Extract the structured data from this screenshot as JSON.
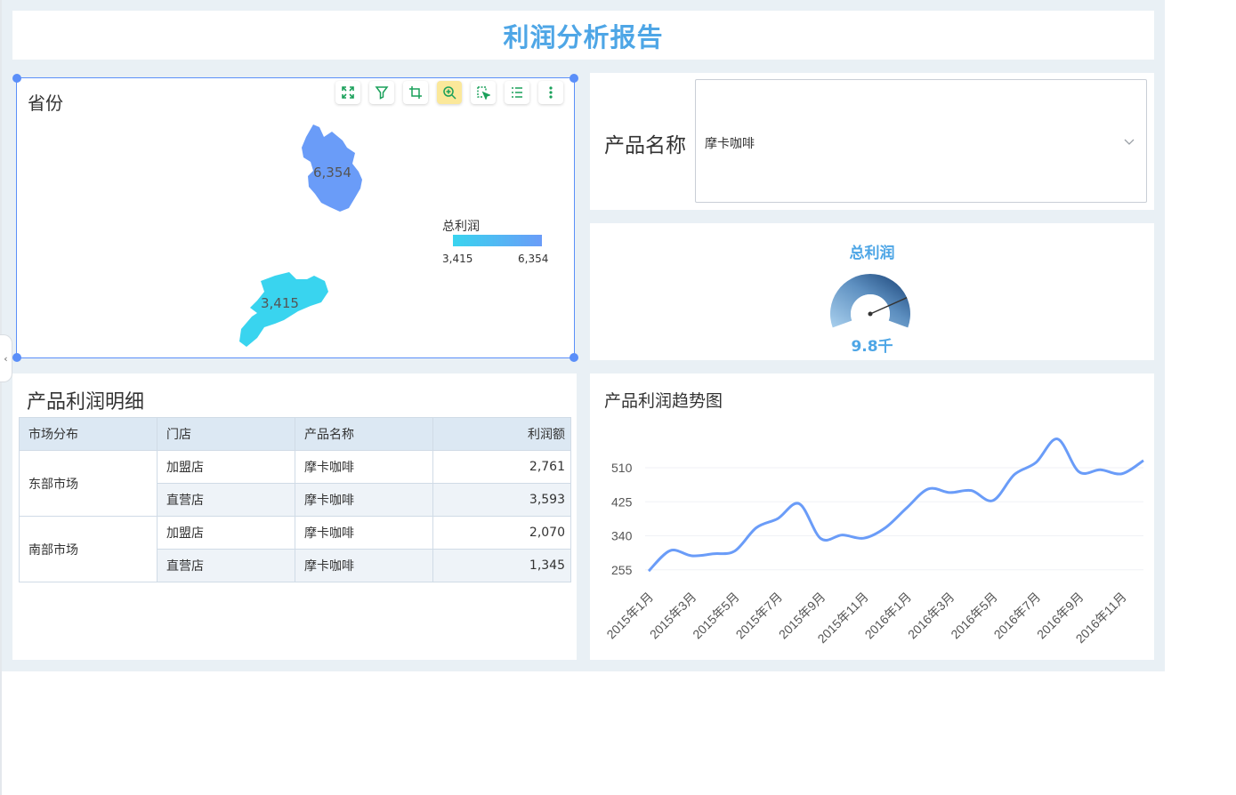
{
  "report": {
    "title": "利润分析报告"
  },
  "map_panel": {
    "title": "省份",
    "toolbar": [
      {
        "icon": "fullscreen-icon",
        "active": false
      },
      {
        "icon": "filter-icon",
        "active": false
      },
      {
        "icon": "crop-icon",
        "active": false
      },
      {
        "icon": "zoom-in-icon",
        "active": true
      },
      {
        "icon": "box-select-icon",
        "active": false
      },
      {
        "icon": "list-icon",
        "active": false
      },
      {
        "icon": "more-vertical-icon",
        "active": false
      }
    ],
    "regions": [
      {
        "name": "安徽",
        "value": 6354,
        "label": "6,354",
        "color": "#6a9cf8"
      },
      {
        "name": "广东",
        "value": 3415,
        "label": "3,415",
        "color": "#39d4ef"
      }
    ],
    "legend": {
      "title": "总利润",
      "min": "3,415",
      "max": "6,354",
      "color_min": "#39d4ef",
      "color_max": "#6a9cf8"
    }
  },
  "filter": {
    "label": "产品名称",
    "selected": "摩卡咖啡"
  },
  "gauge": {
    "title": "总利润",
    "value_label": "9.8千",
    "fraction": 0.8
  },
  "table": {
    "title": "产品利润明细",
    "headers": [
      "市场分布",
      "门店",
      "产品名称",
      "利润额"
    ],
    "groups": [
      {
        "market": "东部市场",
        "rows": [
          {
            "store": "加盟店",
            "product": "摩卡咖啡",
            "profit": "2,761"
          },
          {
            "store": "直营店",
            "product": "摩卡咖啡",
            "profit": "3,593"
          }
        ]
      },
      {
        "market": "南部市场",
        "rows": [
          {
            "store": "加盟店",
            "product": "摩卡咖啡",
            "profit": "2,070"
          },
          {
            "store": "直营店",
            "product": "摩卡咖啡",
            "profit": "1,345"
          }
        ]
      }
    ]
  },
  "chart_data": {
    "type": "line",
    "title": "产品利润趋势图",
    "y_ticks": [
      255,
      340,
      425,
      510
    ],
    "x_tick_labels": [
      "2015年1月",
      "2015年3月",
      "2015年5月",
      "2015年7月",
      "2015年9月",
      "2015年11月",
      "2016年1月",
      "2016年3月",
      "2016年5月",
      "2016年7月",
      "2016年9月",
      "2016年11月"
    ],
    "x": [
      "2015年1月",
      "2015年2月",
      "2015年3月",
      "2015年4月",
      "2015年5月",
      "2015年6月",
      "2015年7月",
      "2015年8月",
      "2015年9月",
      "2015年10月",
      "2015年11月",
      "2015年12月",
      "2016年1月",
      "2016年2月",
      "2016年3月",
      "2016年4月",
      "2016年5月",
      "2016年6月",
      "2016年7月",
      "2016年8月",
      "2016年9月",
      "2016年10月",
      "2016年11月",
      "2016年12月"
    ],
    "series": [
      {
        "values": [
          252,
          303,
          290,
          295,
          302,
          360,
          383,
          420,
          333,
          342,
          334,
          360,
          410,
          457,
          448,
          453,
          428,
          493,
          523,
          582,
          500,
          505,
          495,
          528
        ]
      }
    ],
    "ylim": [
      230,
      590
    ],
    "color": "#6a9cf8",
    "grid": true
  }
}
